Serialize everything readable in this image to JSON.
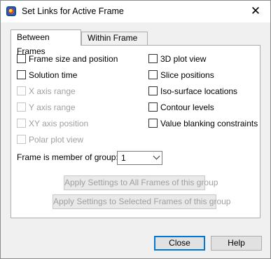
{
  "window": {
    "title": "Set Links for Active Frame",
    "close_glyph": "✕"
  },
  "tabs": [
    {
      "label": "Between Frames",
      "active": true
    },
    {
      "label": "Within Frame",
      "active": false
    }
  ],
  "left_checks": [
    {
      "label": "Frame size and position",
      "checked": false,
      "enabled": true
    },
    {
      "label": "Solution time",
      "checked": false,
      "enabled": true
    },
    {
      "label": "X axis range",
      "checked": false,
      "enabled": false
    },
    {
      "label": "Y axis range",
      "checked": false,
      "enabled": false
    },
    {
      "label": "XY axis position",
      "checked": false,
      "enabled": false
    },
    {
      "label": "Polar plot view",
      "checked": false,
      "enabled": false
    }
  ],
  "right_checks": [
    {
      "label": "3D plot view",
      "checked": false,
      "enabled": true
    },
    {
      "label": "Slice positions",
      "checked": false,
      "enabled": true
    },
    {
      "label": "Iso-surface locations",
      "checked": false,
      "enabled": true
    },
    {
      "label": "Contour levels",
      "checked": false,
      "enabled": true
    },
    {
      "label": "Value blanking constraints",
      "checked": false,
      "enabled": true
    }
  ],
  "group": {
    "label": "Frame is member of group:",
    "value": "1"
  },
  "apply_buttons": {
    "all": "Apply Settings to All Frames of this group",
    "selected": "Apply Settings to Selected Frames of this group"
  },
  "footer": {
    "close": "Close",
    "help": "Help"
  },
  "colors": {
    "accent": "#0078d7",
    "disabled_text": "#a0a0a0"
  }
}
